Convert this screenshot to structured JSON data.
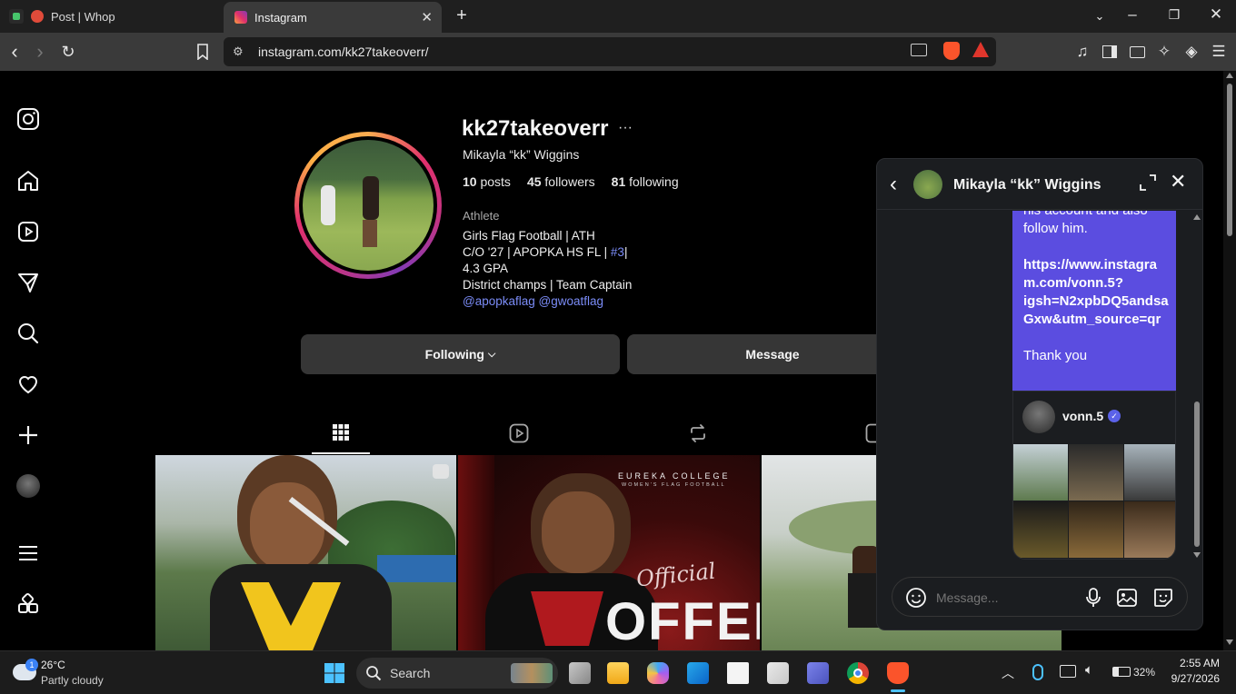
{
  "browser": {
    "tabs": [
      {
        "label": "Post | Whop",
        "active": false
      },
      {
        "label": "Instagram",
        "active": true
      }
    ],
    "url": "instagram.com/kk27takeoverr/",
    "colors": {
      "accent": "#fb542b"
    }
  },
  "profile": {
    "username": "kk27takeoverr",
    "more": "···",
    "full_name": "Mikayla “kk” Wiggins",
    "stats": {
      "posts_num": "10",
      "posts_label": "posts",
      "followers_num": "45",
      "followers_label": "followers",
      "following_num": "81",
      "following_label": "following"
    },
    "category": "Athlete",
    "bio": {
      "line1": "Girls Flag Football | ATH",
      "line2_pre": "C/O '27 | APOPKA HS FL | ",
      "line2_tag": "#3",
      "line2_post": "|",
      "line3": "4.3 GPA",
      "line4": "District champs | Team Captain",
      "mention1": "@apopkaflag",
      "mention2": "@gwoatflag"
    },
    "following_button": "Following",
    "message_button": "Message"
  },
  "posts": [
    {
      "caption": ""
    },
    {
      "overlay_title": "EUREKA COLLEGE",
      "overlay_sub": "WOMEN'S FLAG FOOTBALL",
      "script": "Official",
      "big": "OFFER"
    },
    {
      "caption": ""
    }
  ],
  "chat": {
    "title": "Mikayla “kk” Wiggins",
    "message_lines": [
      "his account and also",
      "follow him.",
      "",
      "https://www.instagra",
      "m.com/vonn.5?",
      "igsh=N2xpbDQ5andsa",
      "Gxw&utm_source=qr",
      "",
      "Thank you"
    ],
    "shared_profile": "vonn.5",
    "input_placeholder": "Message..."
  },
  "taskbar": {
    "weather_temp": "26°C",
    "weather_desc": "Partly cloudy",
    "weather_badge": "1",
    "search_label": "Search",
    "battery": "32%",
    "time": "2:55 AM",
    "date": "9/27/2026"
  }
}
